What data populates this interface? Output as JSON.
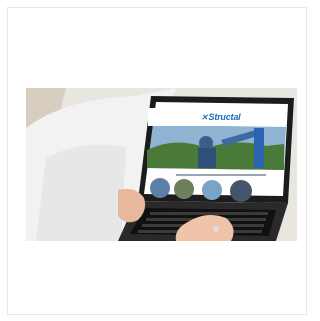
{
  "image": {
    "subject": "laptop-on-lap-showing-website",
    "brand_text": "Structal",
    "colors": {
      "page_bg": "#ffffff",
      "card_border": "#e6e6e6",
      "laptop_bezel": "#1c1c1c",
      "site_accent": "#1d6fb8",
      "hero_sky": "#8fb3d2",
      "hero_trees": "#4a7a3a",
      "sweater": "#ececec"
    }
  }
}
